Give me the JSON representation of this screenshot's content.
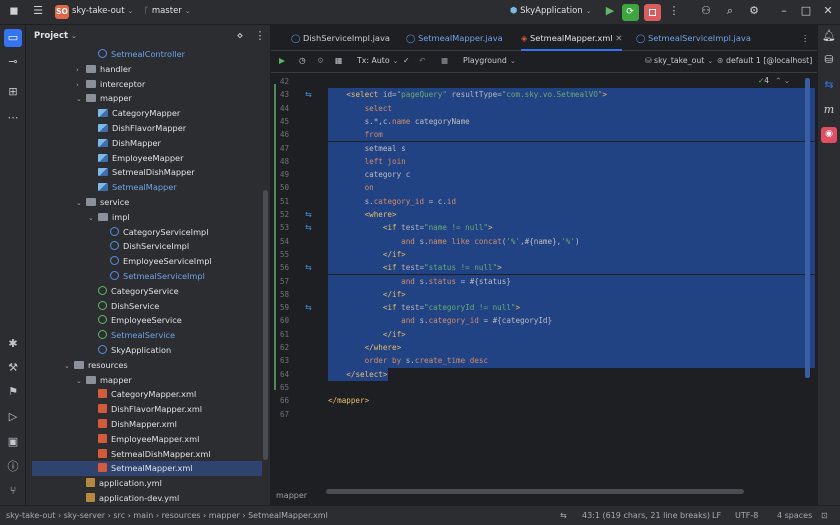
{
  "topbar": {
    "project_badge": "SO",
    "project_name": "sky-take-out",
    "branch": "master",
    "run_config": "SkyApplication"
  },
  "project_panel": {
    "title": "Project",
    "tree": [
      {
        "label": "SetmealController",
        "kind": "class",
        "blue": true,
        "indent": 3,
        "arrow": ""
      },
      {
        "label": "handler",
        "kind": "folder",
        "indent": 2,
        "arrow": "›"
      },
      {
        "label": "interceptor",
        "kind": "folder",
        "indent": 2,
        "arrow": "›"
      },
      {
        "label": "mapper",
        "kind": "folder",
        "indent": 2,
        "arrow": "⌄"
      },
      {
        "label": "CategoryMapper",
        "kind": "mapper",
        "indent": 3,
        "arrow": ""
      },
      {
        "label": "DishFlavorMapper",
        "kind": "mapper",
        "indent": 3,
        "arrow": ""
      },
      {
        "label": "DishMapper",
        "kind": "mapper",
        "indent": 3,
        "arrow": ""
      },
      {
        "label": "EmployeeMapper",
        "kind": "mapper",
        "indent": 3,
        "arrow": ""
      },
      {
        "label": "SetmealDishMapper",
        "kind": "mapper",
        "indent": 3,
        "arrow": ""
      },
      {
        "label": "SetmealMapper",
        "kind": "mapper",
        "blue": true,
        "indent": 3,
        "arrow": ""
      },
      {
        "label": "service",
        "kind": "folder",
        "indent": 2,
        "arrow": "⌄"
      },
      {
        "label": "impl",
        "kind": "folder",
        "indent": 3,
        "arrow": "⌄"
      },
      {
        "label": "CategoryServiceImpl",
        "kind": "class",
        "indent": 4,
        "arrow": ""
      },
      {
        "label": "DishServiceImpl",
        "kind": "class",
        "indent": 4,
        "arrow": ""
      },
      {
        "label": "EmployeeServiceImpl",
        "kind": "class",
        "indent": 4,
        "arrow": ""
      },
      {
        "label": "SetmealServiceImpl",
        "kind": "class",
        "blue": true,
        "indent": 4,
        "arrow": ""
      },
      {
        "label": "CategoryService",
        "kind": "interface",
        "indent": 3,
        "arrow": ""
      },
      {
        "label": "DishService",
        "kind": "interface",
        "indent": 3,
        "arrow": ""
      },
      {
        "label": "EmployeeService",
        "kind": "interface",
        "indent": 3,
        "arrow": ""
      },
      {
        "label": "SetmealService",
        "kind": "interface",
        "blue": true,
        "indent": 3,
        "arrow": ""
      },
      {
        "label": "SkyApplication",
        "kind": "class",
        "indent": 3,
        "arrow": ""
      },
      {
        "label": "resources",
        "kind": "folder",
        "indent": 1,
        "arrow": "⌄"
      },
      {
        "label": "mapper",
        "kind": "folder",
        "indent": 2,
        "arrow": "⌄"
      },
      {
        "label": "CategoryMapper.xml",
        "kind": "xml",
        "indent": 3,
        "arrow": ""
      },
      {
        "label": "DishFlavorMapper.xml",
        "kind": "xml",
        "indent": 3,
        "arrow": ""
      },
      {
        "label": "DishMapper.xml",
        "kind": "xml",
        "indent": 3,
        "arrow": ""
      },
      {
        "label": "EmployeeMapper.xml",
        "kind": "xml",
        "indent": 3,
        "arrow": ""
      },
      {
        "label": "SetmealDishMapper.xml",
        "kind": "xml",
        "indent": 3,
        "arrow": ""
      },
      {
        "label": "SetmealMapper.xml",
        "kind": "xml",
        "indent": 3,
        "arrow": "",
        "selected": true
      },
      {
        "label": "application.yml",
        "kind": "yml",
        "indent": 2,
        "arrow": ""
      },
      {
        "label": "application-dev.yml",
        "kind": "yml",
        "indent": 2,
        "arrow": ""
      }
    ]
  },
  "tabs": [
    {
      "label": "DishServiceImpl.java",
      "active": false,
      "blue": false
    },
    {
      "label": "SetmealMapper.java",
      "active": false,
      "blue": true
    },
    {
      "label": "SetmealMapper.xml",
      "active": true,
      "blue": false
    },
    {
      "label": "SetmealServiceImpl.java",
      "active": false,
      "blue": true
    }
  ],
  "editor_toolbar": {
    "tx": "Tx: Auto",
    "playground": "Playground",
    "datasource": "sky_take_out",
    "schema": "default 1 [@localhost]",
    "check_count": "4"
  },
  "code_lines": [
    {
      "n": "42",
      "html": ""
    },
    {
      "n": "43",
      "html": "    <span class='tag'>&lt;select</span> <span class='att'>id=</span><span class='str'>\"pageQuery\"</span> <span class='att'>resultType=</span><span class='str'>\"com.sky.vo.SetmealVO\"</span><span class='tag'>&gt;</span>"
    },
    {
      "n": "44",
      "html": "        <span class='kw'>select</span>"
    },
    {
      "n": "45",
      "html": "        <span class='txt'>s.*,c.</span><span class='kw'>name</span><span class='txt'> categoryName</span>"
    },
    {
      "n": "46",
      "html": "        <span class='kw'>from</span>"
    },
    {
      "n": "47",
      "html": "        <span class='txt'>setmeal s</span>"
    },
    {
      "n": "48",
      "html": "        <span class='kw'>left join</span>"
    },
    {
      "n": "49",
      "html": "        <span class='txt'>category c</span>"
    },
    {
      "n": "50",
      "html": "        <span class='kw'>on</span>"
    },
    {
      "n": "51",
      "html": "        <span class='txt'>s.</span><span class='kw'>category_id</span><span class='txt'> = c.</span><span class='kw'>id</span>"
    },
    {
      "n": "52",
      "html": "        <span class='tag'>&lt;where&gt;</span>"
    },
    {
      "n": "53",
      "html": "            <span class='tag'>&lt;if</span> <span class='att'>test=</span><span class='str'>\"name != null\"</span><span class='tag'>&gt;</span>"
    },
    {
      "n": "54",
      "html": "                <span class='kw'>and</span><span class='txt'> s.</span><span class='kw'>name</span> <span class='kw'>like</span> <span class='kw'>concat</span><span class='txt'>(</span><span class='str'>'%'</span><span class='txt'>,#{name},</span><span class='str'>'%'</span><span class='txt'>)</span>"
    },
    {
      "n": "55",
      "html": "            <span class='tag'>&lt;/if&gt;</span>"
    },
    {
      "n": "56",
      "html": "            <span class='tag'>&lt;if</span> <span class='att'>test=</span><span class='str'>\"status != null\"</span><span class='tag'>&gt;</span>"
    },
    {
      "n": "57",
      "html": "                <span class='kw'>and</span><span class='txt'> s.</span><span class='kw'>status</span><span class='txt'> = #{status}</span>"
    },
    {
      "n": "58",
      "html": "            <span class='tag'>&lt;/if&gt;</span>"
    },
    {
      "n": "59",
      "html": "            <span class='tag'>&lt;if</span> <span class='att'>test=</span><span class='str'>\"categoryId != null\"</span><span class='tag'>&gt;</span>"
    },
    {
      "n": "60",
      "html": "                <span class='kw'>and</span><span class='txt'> s.</span><span class='kw'>category_id</span><span class='txt'> = #{categoryId}</span>"
    },
    {
      "n": "61",
      "html": "            <span class='tag'>&lt;/if&gt;</span>"
    },
    {
      "n": "62",
      "html": "        <span class='tag'>&lt;/where&gt;</span>"
    },
    {
      "n": "63",
      "html": "        <span class='kw'>order by</span><span class='txt'> s.</span><span class='kw'>create_time</span> <span class='kw'>desc</span>"
    },
    {
      "n": "64",
      "html": "    <span class='tag'>&lt;/select&gt;</span>"
    },
    {
      "n": "65",
      "html": ""
    },
    {
      "n": "66",
      "html": "<span class='tag'>&lt;/mapper&gt;</span>"
    },
    {
      "n": "67",
      "html": ""
    }
  ],
  "editor_breadcrumb": "mapper",
  "statusbar": {
    "path": [
      "sky-take-out",
      "sky-server",
      "src",
      "main",
      "resources",
      "mapper",
      "SetmealMapper.xml"
    ],
    "position": "43:1 (619 chars, 21 line breaks)",
    "line_sep": "LF",
    "encoding": "UTF-8",
    "indent": "4 spaces"
  },
  "colors": {
    "accent": "#3574f0",
    "selection": "#214283",
    "run_green": "#3fa63f",
    "stop_red": "#db5c5c"
  }
}
